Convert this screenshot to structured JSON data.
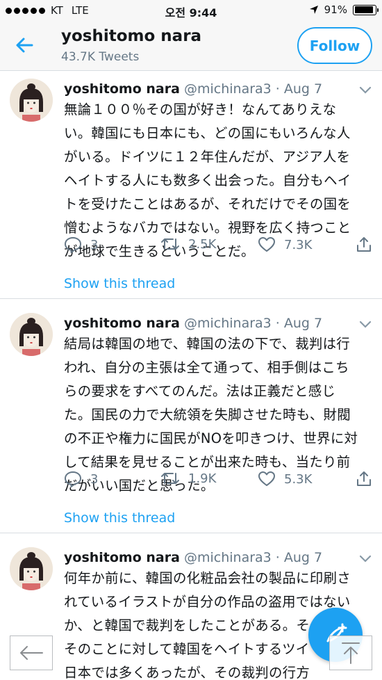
{
  "status_bar": {
    "carrier": "KT",
    "network": "LTE",
    "time": "오전 9:44",
    "battery": "91%",
    "battery_level": 0.91
  },
  "header": {
    "title": "yoshitomo nara",
    "subtitle": "43.7K Tweets",
    "follow_label": "Follow"
  },
  "tweets": [
    {
      "name": "yoshitomo nara",
      "meta": "@michinara3 · Aug 7",
      "text": "無論１００％その国が好き！なんてありえな\nい。韓国にも日本にも、どの国にもいろんな人\nがいる。ドイツに１２年住んだが、アジア人を\nヘイトする人にも数多く出会った。自分もヘイ\nトを受けたことはあるが、それだけでその国を\n憎むようなバカではない。視野を広く持つこと\nが地球で生きるということだ。",
      "replies": "3",
      "retweets": "2.5K",
      "likes": "7.3K",
      "thread_link": "Show this thread"
    },
    {
      "name": "yoshitomo nara",
      "meta": "@michinara3 · Aug 7",
      "text": "結局は韓国の地で、韓国の法の下で、裁判は行\nわれ、自分の主張は全て通って、相手側はこち\nらの要求をすべてのんだ。法は正義だと感じ\nた。国民の力で大統領を失脚させた時も、財閥\nの不正や権力に国民がNOを叩きつけ、世界に対\nして結果を見せることが出来た時も、当たり前\nだがいい国だと思った。",
      "replies": "3",
      "retweets": "1.9K",
      "likes": "5.3K",
      "thread_link": "Show this thread"
    },
    {
      "name": "yoshitomo nara",
      "meta": "@michinara3 · Aug 7",
      "text": "何年か前に、韓国の化粧品会社の製品に印刷さ\nれているイラストが自分の作品の盗用ではない\nか、と韓国で裁判をしたことがある。そ\nそのことに対して韓国をヘイトするツイ\n日本では多くあったが、その裁判の行方\nに対しては不思議なほどに彼らは無関心だっ"
    }
  ],
  "icons": {
    "back": "back-arrow-icon",
    "chevron": "chevron-down-icon",
    "reply": "reply-icon",
    "retweet": "retweet-icon",
    "like": "heart-icon",
    "share": "share-icon",
    "compose": "compose-icon",
    "nav_back": "nav-back-icon",
    "scroll_top": "scroll-to-top-icon"
  },
  "colors": {
    "accent": "#1da1f2",
    "secondary_text": "#657786",
    "text": "#14171a",
    "divider": "#d8dde1"
  }
}
